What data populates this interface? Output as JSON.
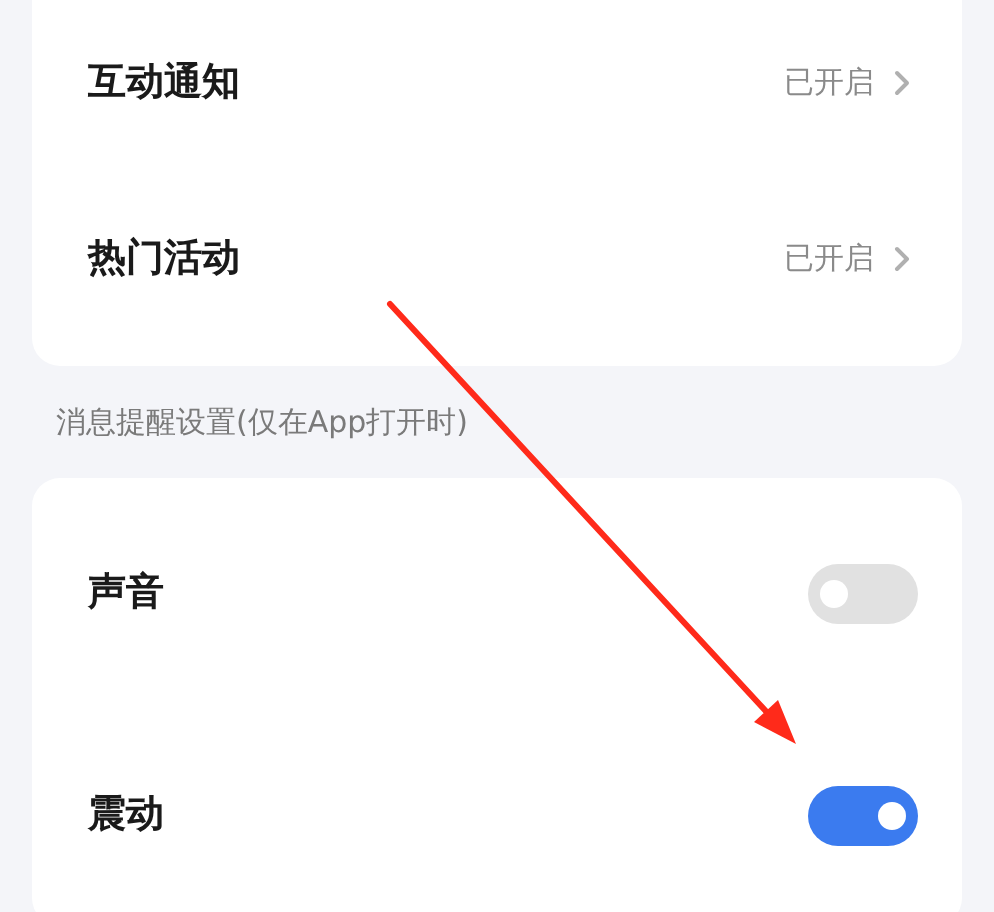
{
  "notification_list": [
    {
      "kind": "link",
      "label": "互动通知",
      "value": "已开启"
    },
    {
      "kind": "link",
      "label": "热门活动",
      "value": "已开启"
    }
  ],
  "reminder_section": {
    "title": "消息提醒设置(仅在App打开时)",
    "items": [
      {
        "kind": "toggle",
        "label": "声音",
        "on": false
      },
      {
        "kind": "toggle",
        "label": "震动",
        "on": true
      }
    ]
  },
  "annotation": {
    "kind": "arrow",
    "color": "#ff2a1a"
  }
}
